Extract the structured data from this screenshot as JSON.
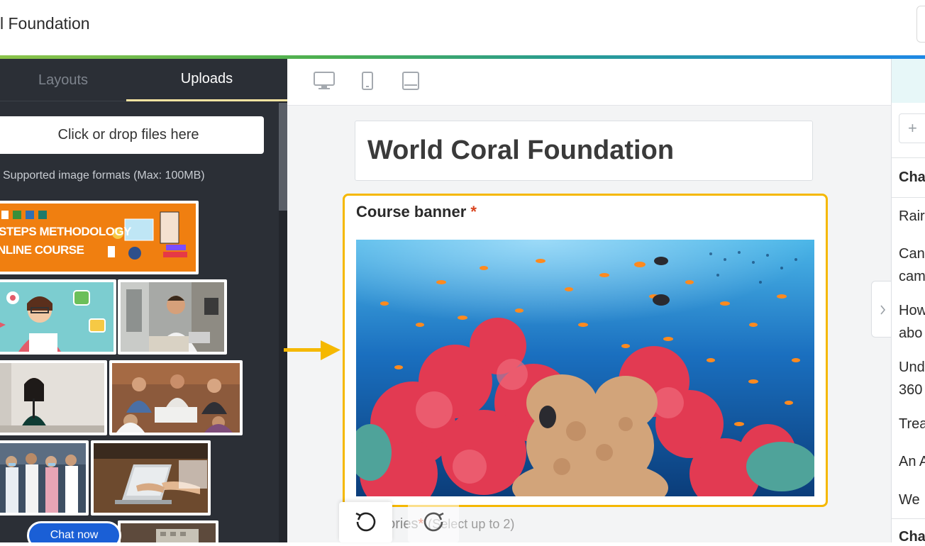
{
  "header": {
    "title": "l Foundation"
  },
  "left_panel": {
    "tabs": [
      {
        "label": "Layouts"
      },
      {
        "label": "Uploads"
      }
    ],
    "dropzone_label": "Click or drop files here",
    "formats_note": "Supported image formats (Max: 100MB)",
    "thumbnails": [
      {
        "name": "steps-methodology-banner",
        "lines": [
          "STEPS METHODOLOGY",
          "NLINE COURSE"
        ]
      },
      {
        "name": "illustration-support-agent"
      },
      {
        "name": "photo-man-on-phone"
      },
      {
        "name": "photo-woman-presenting"
      },
      {
        "name": "photo-team-meeting"
      },
      {
        "name": "photo-medical-team"
      },
      {
        "name": "photo-laptop-handshake"
      },
      {
        "name": "photo-partial-bottom"
      }
    ],
    "chat_label": "Chat now"
  },
  "device_bar": {
    "icons": [
      "desktop-icon",
      "mobile-icon",
      "tablet-icon"
    ]
  },
  "canvas": {
    "page_title": "World Coral Foundation",
    "banner_label": "Course banner",
    "required_mark": "*",
    "categories_label": "gories",
    "categories_hint": "(Select up to 2)"
  },
  "right_panel": {
    "add_symbol": "+",
    "lines": [
      "Cha",
      "Rair",
      "Can",
      "cam",
      "How",
      "abo",
      "Und",
      "360",
      "Trea",
      "An A",
      "We",
      "Cha"
    ]
  },
  "colors": {
    "highlight": "#f5b800",
    "dark_panel": "#2b2f36",
    "chat_button": "#1a5fd6",
    "required": "#d9431e"
  }
}
